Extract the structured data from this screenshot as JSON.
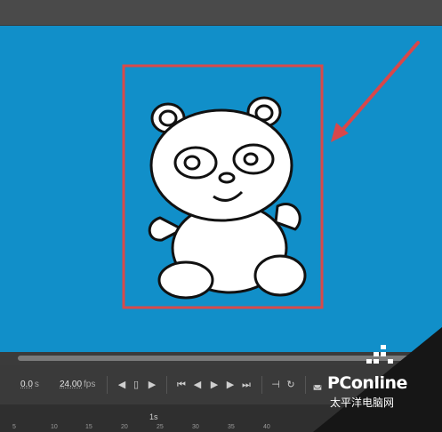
{
  "timeline": {
    "time_value": "0.0",
    "time_unit": "s",
    "fps_value": "24.00",
    "fps_unit": "fps",
    "ruler_second_label": "1s",
    "ruler_labels": [
      "5",
      "10",
      "15",
      "20",
      "25",
      "30",
      "35",
      "40"
    ]
  },
  "canvas": {
    "background": "#118fc9",
    "highlight_box_color": "#d84a4a",
    "arrow_color": "#d8474a"
  },
  "watermark": {
    "brand": "PConline",
    "chinese": "太平洋电脑网"
  },
  "icons": [
    "panda-drawing",
    "red-arrow-icon",
    "first-frame-icon",
    "step-back-icon",
    "play-icon",
    "step-forward-icon",
    "last-frame-icon",
    "insert-frame-icon",
    "onion-skin-icon",
    "loop-icon"
  ]
}
